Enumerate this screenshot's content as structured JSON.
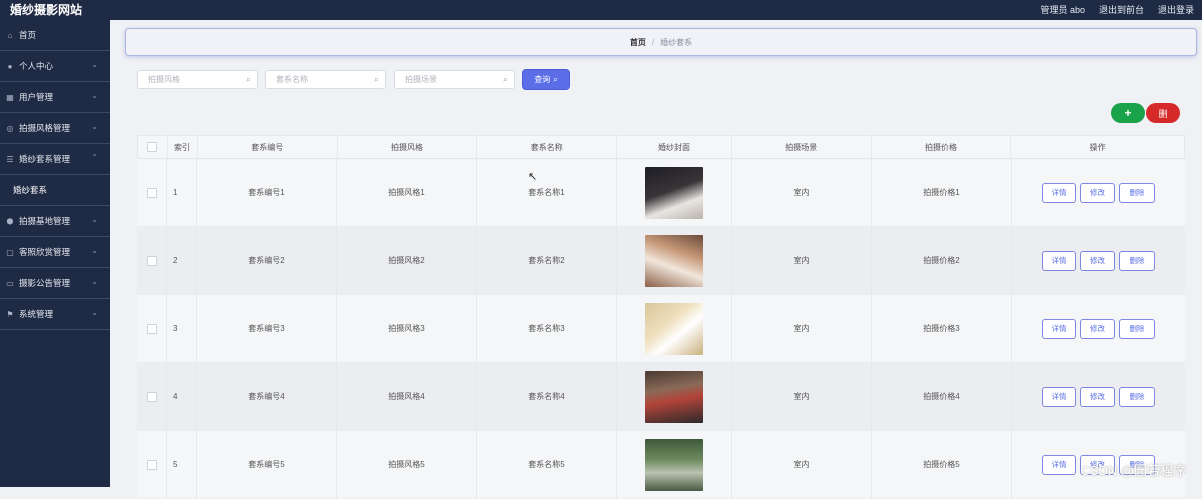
{
  "app": {
    "title": "婚纱摄影网站"
  },
  "topbar": {
    "admin_label": "管理员 abo",
    "back_front": "退出到前台",
    "logout": "退出登录"
  },
  "sidebar": {
    "items": [
      {
        "label": "首页",
        "icon": "home-icon",
        "has_arrow": false
      },
      {
        "label": "个人中心",
        "icon": "user-icon",
        "has_arrow": true
      },
      {
        "label": "用户管理",
        "icon": "grid-icon",
        "has_arrow": true
      },
      {
        "label": "拍摄风格管理",
        "icon": "camera-icon",
        "has_arrow": true
      },
      {
        "label": "婚纱套系管理",
        "icon": "list-icon",
        "has_arrow": true,
        "expanded": true
      },
      {
        "label": "婚纱套系",
        "sub": true
      },
      {
        "label": "拍摄基地管理",
        "icon": "shield-icon",
        "has_arrow": true
      },
      {
        "label": "客照欣赏管理",
        "icon": "image-icon",
        "has_arrow": true
      },
      {
        "label": "摄影公告管理",
        "icon": "notice-icon",
        "has_arrow": true
      },
      {
        "label": "系统管理",
        "icon": "flag-icon",
        "has_arrow": true
      }
    ]
  },
  "breadcrumb": {
    "home": "首页",
    "separator": "/",
    "current": "婚纱套系"
  },
  "search": {
    "style_placeholder": "拍摄风格",
    "name_placeholder": "套系名称",
    "scene_placeholder": "拍摄场景",
    "query_label": "查询"
  },
  "actions": {
    "add_label": "+",
    "delete_label": "删"
  },
  "table": {
    "headers": {
      "index": "索引",
      "code": "套系编号",
      "style": "拍摄风格",
      "name": "套系名称",
      "photo": "婚纱封面",
      "scene": "拍摄场景",
      "price": "拍摄价格",
      "ops": "操作"
    },
    "rows": [
      {
        "index": "1",
        "code": "套系编号1",
        "style": "拍摄风格1",
        "name": "套系名称1",
        "scene": "室内",
        "price": "拍摄价格1"
      },
      {
        "index": "2",
        "code": "套系编号2",
        "style": "拍摄风格2",
        "name": "套系名称2",
        "scene": "室内",
        "price": "拍摄价格2"
      },
      {
        "index": "3",
        "code": "套系编号3",
        "style": "拍摄风格3",
        "name": "套系名称3",
        "scene": "室内",
        "price": "拍摄价格3"
      },
      {
        "index": "4",
        "code": "套系编号4",
        "style": "拍摄风格4",
        "name": "套系名称4",
        "scene": "室内",
        "price": "拍摄价格4"
      },
      {
        "index": "5",
        "code": "套系编号5",
        "style": "拍摄风格5",
        "name": "套系名称5",
        "scene": "室内",
        "price": "拍摄价格5"
      }
    ],
    "op_labels": {
      "detail": "详情",
      "edit": "修改",
      "delete": "删除"
    }
  },
  "watermark": "CSDN @园若程序",
  "colors": {
    "sidebar_bg": "#1f2a44",
    "primary": "#5b6ee8",
    "add_green": "#1aa34a",
    "delete_red": "#d62a2a"
  }
}
